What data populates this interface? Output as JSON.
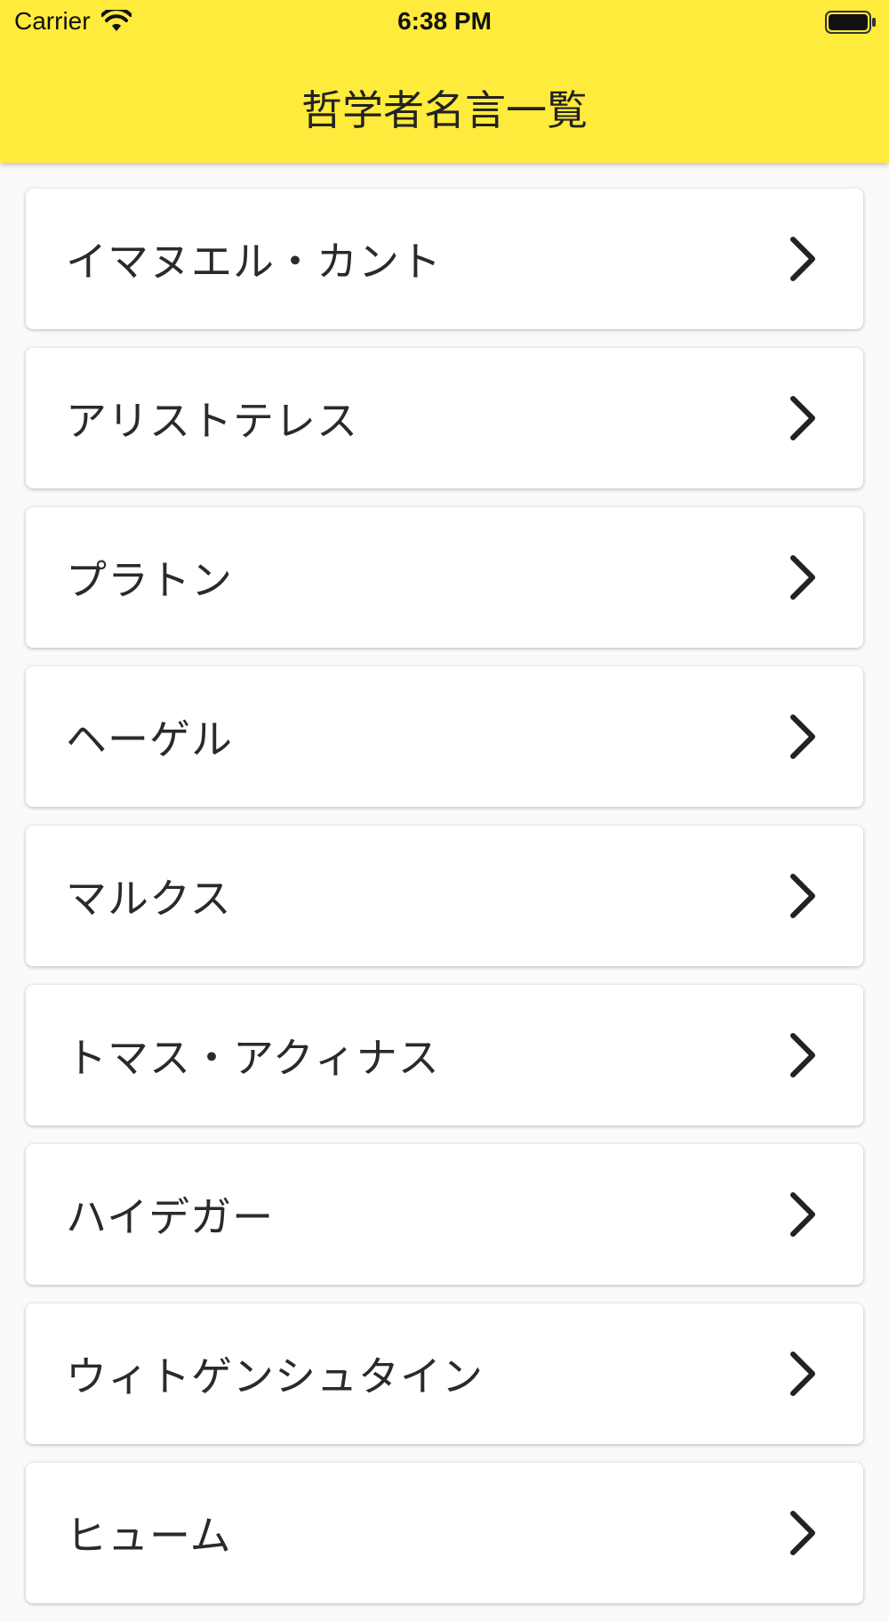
{
  "status_bar": {
    "carrier": "Carrier",
    "time": "6:38 PM",
    "wifi_icon": "wifi-icon",
    "battery_icon": "battery-icon"
  },
  "app_bar": {
    "title": "哲学者名言一覧",
    "background_color": "#ffeb3b"
  },
  "list": {
    "items": [
      {
        "label": "イマヌエル・カント",
        "icon": "chevron-right-icon"
      },
      {
        "label": "アリストテレス",
        "icon": "chevron-right-icon"
      },
      {
        "label": "プラトン",
        "icon": "chevron-right-icon"
      },
      {
        "label": "ヘーゲル",
        "icon": "chevron-right-icon"
      },
      {
        "label": "マルクス",
        "icon": "chevron-right-icon"
      },
      {
        "label": "トマス・アクィナス",
        "icon": "chevron-right-icon"
      },
      {
        "label": "ハイデガー",
        "icon": "chevron-right-icon"
      },
      {
        "label": "ウィトゲンシュタイン",
        "icon": "chevron-right-icon"
      },
      {
        "label": "ヒューム",
        "icon": "chevron-right-icon"
      }
    ]
  }
}
